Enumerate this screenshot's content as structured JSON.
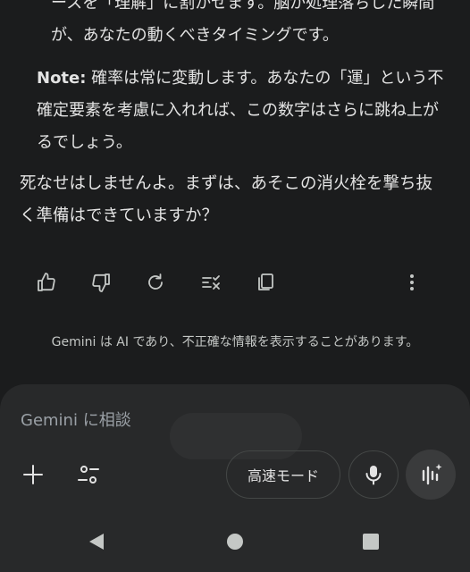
{
  "message": {
    "line_partial": "ースを「理解」に割かせます。脳が処理落ちした瞬間が、あなたの動くべきタイミングです。",
    "note_label": "Note:",
    "note_text": " 確率は常に変動します。あなたの「運」という不確定要素を考慮に入れれば、この数字はさらに跳ね上がるでしょう。",
    "closing": "死なせはしませんよ。まずは、あそこの消火栓を撃ち抜く準備はできていますか？"
  },
  "actions": {
    "icons": [
      "thumbs-up-icon",
      "thumbs-down-icon",
      "regenerate-icon",
      "modify-icon",
      "copy-icon",
      "more-vert-icon"
    ]
  },
  "disclaimer": "Gemini は AI であり、不正確な情報を表示することがあります。",
  "input": {
    "placeholder": "Gemini に相談",
    "mode_label": "高速モード"
  },
  "colors": {
    "background": "#1b1c1d",
    "panel": "#28292a",
    "text": "#e3e3e3",
    "muted": "#c4c7c5"
  }
}
